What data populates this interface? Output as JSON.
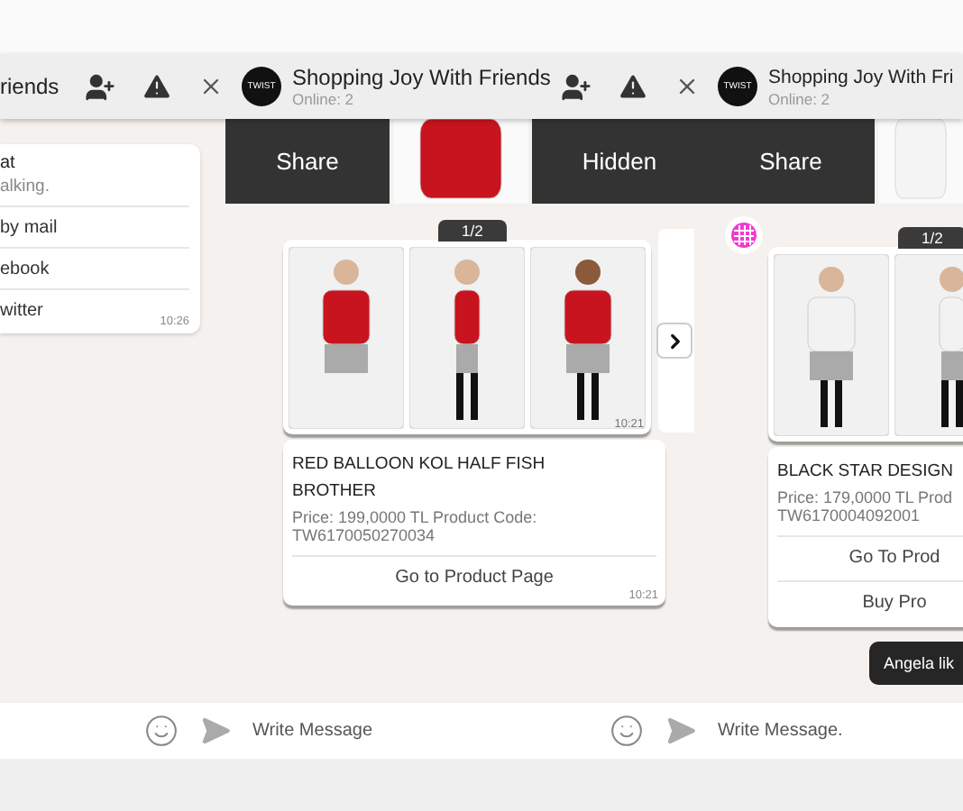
{
  "headers": [
    {
      "title": "riends",
      "tools": true
    },
    {
      "title": "Shopping Joy With Friends",
      "status": "Online: 2",
      "logo": "TWIST",
      "tools": true
    },
    {
      "title": "Shopping Joy With Fri",
      "status": "Online: 2",
      "logo": "TWIST",
      "tools": false
    }
  ],
  "menu_card": {
    "title": "at",
    "subtitle": "alking.",
    "options": [
      "by mail",
      "ebook",
      "witter"
    ],
    "time": "10:26"
  },
  "strips": [
    [
      {
        "kind": "action",
        "label": "Share"
      },
      {
        "kind": "photo"
      },
      {
        "kind": "action",
        "label": "Hidden"
      }
    ],
    [
      {
        "kind": "action",
        "label": "Share"
      },
      {
        "kind": "photo"
      }
    ]
  ],
  "products": [
    {
      "avatar": false,
      "counter": "1/2",
      "photos": [
        {
          "kind": "red-front"
        },
        {
          "kind": "red-side"
        },
        {
          "kind": "red-back"
        }
      ],
      "photo_time": "10:21",
      "next": true,
      "name": "RED BALLOON KOL HALF FISH BROTHER",
      "details": [
        "Price: 199,0000 TL Product Code:",
        "TW6170050270034"
      ],
      "actions": [
        "Go to Product Page"
      ],
      "time": "10:21"
    },
    {
      "avatar": true,
      "counter": "1/2",
      "photos": [
        {
          "kind": "white-front"
        },
        {
          "kind": "white-side"
        }
      ],
      "next": false,
      "name": "BLACK STAR DESIGN",
      "details": [
        "Price: 179,0000 TL Prod",
        "TW6170004092001"
      ],
      "actions": [
        "Go To Prod",
        "Buy Pro"
      ]
    }
  ],
  "tooltip": "Angela lik",
  "composers": [
    {
      "placeholder": "Write Message"
    },
    {
      "placeholder": "Write Message."
    }
  ]
}
